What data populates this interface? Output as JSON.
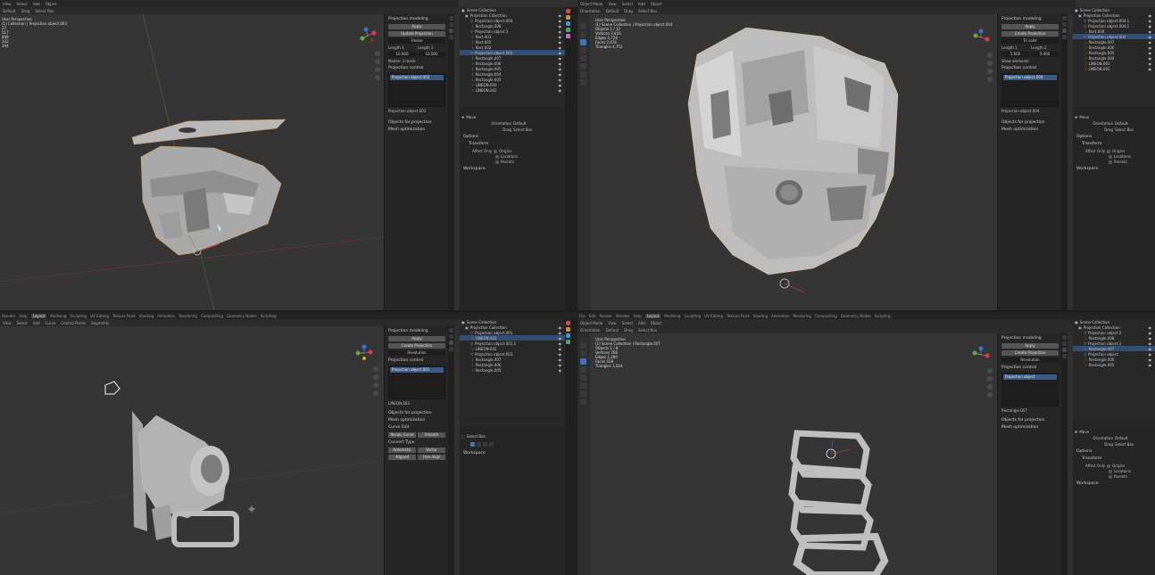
{
  "tl": {
    "menu": [
      "View",
      "Select",
      "Add",
      "Object"
    ],
    "header": [
      "Default",
      "Drag",
      "Select Box"
    ],
    "stats_title": "User Perspective",
    "stats_sub": "(1) Collection | Projection object.003",
    "stats_values": [
      "27",
      "517",
      "848",
      "332",
      "294"
    ],
    "npanel": {
      "section1": "Projection modeling",
      "apply_label": "Apply",
      "btn2_label": "Update Projection",
      "btn3_label": "Freeze",
      "length_label": "Length 1",
      "length2_label": "Length 2",
      "val1": "10.000",
      "val2": "10.000",
      "mode_label": "Modes: 2 mesh",
      "section2": "Projection control",
      "list_item": "Projection object.003",
      "obj_label": "Projection object.003",
      "section3": "Objects for projection",
      "section4": "Mesh optimization"
    },
    "outliner": {
      "title": "Scene Collection",
      "items": [
        {
          "label": "Projection Collection",
          "sel": false
        },
        {
          "label": "Projection object.004",
          "sel": false
        },
        {
          "label": "Rectangle.008",
          "sel": false
        },
        {
          "label": "Projection object.3",
          "sel": false
        },
        {
          "label": "Rect.003",
          "sel": false
        },
        {
          "label": "Rect.001",
          "sel": false
        },
        {
          "label": "Rect.002",
          "sel": false
        },
        {
          "label": "Projection object.003",
          "sel": true
        },
        {
          "label": "Rectangle.007",
          "sel": false
        },
        {
          "label": "Rectangle.006",
          "sel": false
        },
        {
          "label": "Rectangle.005",
          "sel": false
        },
        {
          "label": "Rectangle.004",
          "sel": false
        },
        {
          "label": "Rectangle.003",
          "sel": false
        },
        {
          "label": "LINEON.003",
          "sel": false
        },
        {
          "label": "LINEON.002",
          "sel": false
        }
      ]
    },
    "props": {
      "move": "Move",
      "orientation": "Orientation",
      "orientation_val": "Default",
      "drag": "Drag",
      "drag_val": "Select Box",
      "options": "Options",
      "transform": "Transform",
      "affect_only": "Affect Only",
      "origins": "Origins",
      "locations": "Locations",
      "parents": "Parents",
      "workspace": "Workspace"
    }
  },
  "tr": {
    "menu": [
      "Object Mode",
      "View",
      "Select",
      "Add",
      "Object"
    ],
    "header": [
      "Orientation",
      "Default",
      "Drag",
      "Select Box"
    ],
    "stats_title": "User Perspective",
    "stats_sub": "(1) Scene Collection | Projection object.004",
    "stats_lines": [
      "Objects 1 / 12",
      "Vertices 2,816",
      "Edges 4,728",
      "Faces 2,474",
      "Triangles 4,752"
    ],
    "npanel": {
      "section1": "Projection modeling",
      "apply_label": "Apply",
      "btn2_label": "Create Projection",
      "mode_label": "Tri solid",
      "length_label": "Length 1",
      "length2_label": "Length 2",
      "val1": "5.000",
      "val2": "5.000",
      "mode2": "Show elements",
      "section2": "Projection control",
      "list_item": "Projection object.004",
      "obj_label": "Projection object.004",
      "section3": "Objects for projection",
      "section4": "Mesh optimization"
    },
    "outliner": {
      "title": "Scene Collection",
      "items": [
        {
          "label": "Projection Collection",
          "sel": false
        },
        {
          "label": "Projection object.004.1",
          "sel": false
        },
        {
          "label": "Projection object.004.1",
          "sel": false
        },
        {
          "label": "Rect.009",
          "sel": false
        },
        {
          "label": "Projection object.004",
          "sel": true
        },
        {
          "label": "Rectangle.007",
          "sel": false
        },
        {
          "label": "Rectangle.006",
          "sel": false
        },
        {
          "label": "Rectangle.005",
          "sel": false
        },
        {
          "label": "Rectangle.004",
          "sel": false
        },
        {
          "label": "LINEON.003",
          "sel": false
        },
        {
          "label": "LINEON.001",
          "sel": false
        }
      ]
    },
    "props": {
      "move": "Move",
      "orientation": "Orientation",
      "orientation_val": "Default",
      "drag": "Drag",
      "drag_val": "Select Box",
      "options": "Options",
      "transform": "Transform",
      "affect_only": "Affect Only",
      "origins": "Origins",
      "locations": "Locations",
      "parents": "Parents",
      "workspace": "Workspace"
    }
  },
  "bl": {
    "topbar": [
      "Blender",
      "Help",
      "Layout",
      "Modeling",
      "Sculpting",
      "UV Editing",
      "Texture Paint",
      "Shading",
      "Animation",
      "Rendering",
      "Compositing",
      "Geometry Nodes",
      "Scripting"
    ],
    "menu": [
      "View",
      "Select",
      "Add",
      "Curve",
      "Control Points",
      "Segments"
    ],
    "npanel": {
      "section1": "Projection modeling",
      "apply_label": "Apply",
      "btn2_label": "Create Projection",
      "mode_label": "Revolution",
      "section2": "Projection control",
      "list_item": "Projection object.001",
      "obj_label": "LINEON.003",
      "section3": "Objects for projection",
      "section4": "Mesh optimization",
      "section5": "Curve Edit",
      "b1": "Recalc Curve",
      "b2": "Smooth",
      "section6": "Convert Type",
      "c1": "Automatic",
      "c2": "Vector",
      "c3": "Aligned",
      "c4": "Free Align"
    },
    "outliner": {
      "title": "Scene Collection",
      "items": [
        {
          "label": "Projection Collection",
          "sel": false
        },
        {
          "label": "Projection object.001",
          "sel": false
        },
        {
          "label": "LINEON.003",
          "sel": true
        },
        {
          "label": "Projection object.001.1",
          "sel": false
        },
        {
          "label": "LINEON.002",
          "sel": false
        },
        {
          "label": "Projection object.003",
          "sel": false
        },
        {
          "label": "Rectangle.007",
          "sel": false
        },
        {
          "label": "Rectangle.006",
          "sel": false
        },
        {
          "label": "Rectangle.005",
          "sel": false
        }
      ]
    },
    "props": {
      "select_box": "Select Box",
      "workspace": "Workspace"
    }
  },
  "br": {
    "topbar": [
      "File",
      "Edit",
      "Render",
      "Window",
      "Help",
      "Layout",
      "Modeling",
      "Sculpting",
      "UV Editing",
      "Texture Paint",
      "Shading",
      "Animation",
      "Rendering",
      "Compositing",
      "Geometry Nodes",
      "Scripting"
    ],
    "menu": [
      "Object Mode",
      "View",
      "Select",
      "Add",
      "Object"
    ],
    "header": [
      "Orientation",
      "Default",
      "Drag",
      "Select Box"
    ],
    "stats_title": "User Perspective",
    "stats_sub": "(1) Scene Collection | Rectangle.007",
    "stats_lines": [
      "Objects 1 / 8",
      "Vertices 768",
      "Edges 1,280",
      "Faces 528",
      "Triangles 1,024"
    ],
    "npanel": {
      "section1": "Projection modeling",
      "apply_label": "Apply",
      "btn2_label": "Create Projection",
      "mode_label": "Revolution",
      "section2": "Projection control",
      "list_item": "Projection object",
      "obj_label": "Rectangle.007",
      "section3": "Objects for projection",
      "section4": "Mesh optimization"
    },
    "outliner": {
      "title": "Scene Collection",
      "items": [
        {
          "label": "Projection Collection",
          "sel": false
        },
        {
          "label": "Projection object.2",
          "sel": false
        },
        {
          "label": "Rectangle.008",
          "sel": false
        },
        {
          "label": "Projection object.1",
          "sel": false
        },
        {
          "label": "Rectangle.007",
          "sel": true
        },
        {
          "label": "Projection object",
          "sel": false
        },
        {
          "label": "Rectangle.006",
          "sel": false
        },
        {
          "label": "Rectangle.005",
          "sel": false
        }
      ]
    },
    "props": {
      "move": "Move",
      "orientation": "Orientation",
      "orientation_val": "Default",
      "drag": "Drag",
      "drag_val": "Select Box",
      "options": "Options",
      "transform": "Transform",
      "affect_only": "Affect Only",
      "origins": "Origins",
      "locations": "Locations",
      "parents": "Parents",
      "workspace": "Workspace"
    }
  },
  "colors": {
    "accent": "#4772b3",
    "selected": "#334d73",
    "axis_x": "#d04050",
    "axis_y": "#70a040",
    "axis_z": "#4070d0",
    "mesh": "#b9b9b9"
  },
  "icons": [
    "eye-icon",
    "camera-icon",
    "mesh-icon",
    "curve-icon",
    "collection-icon",
    "cursor-icon",
    "move-icon",
    "rotate-icon",
    "scale-icon",
    "zoom-icon",
    "hand-icon"
  ]
}
